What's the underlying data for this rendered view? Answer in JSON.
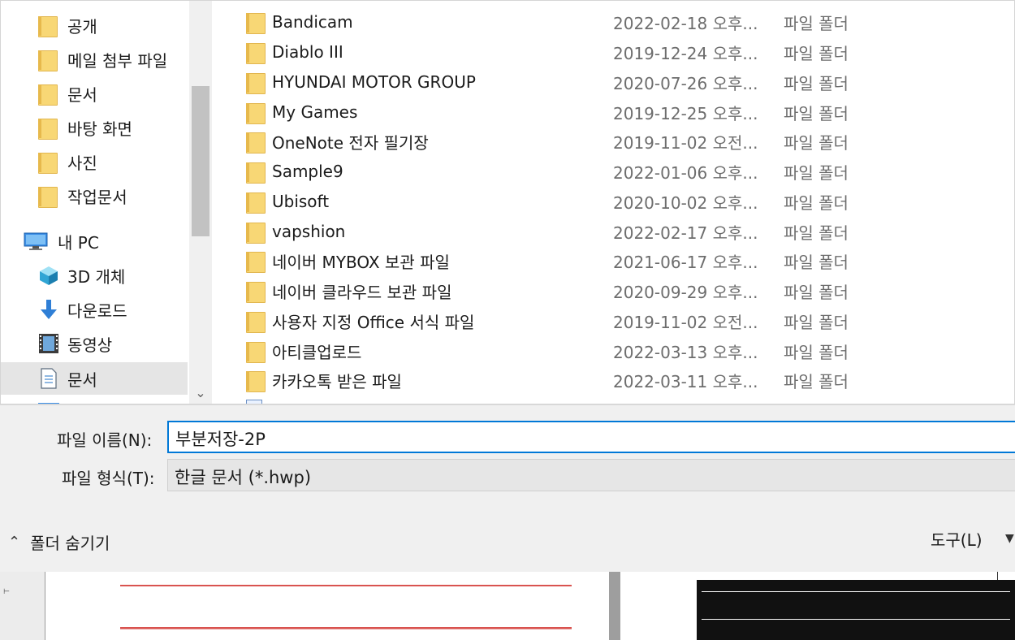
{
  "nav": {
    "items": [
      {
        "label": "공개",
        "icon": "folder-icon"
      },
      {
        "label": "메일 첨부 파일",
        "icon": "folder-icon"
      },
      {
        "label": "문서",
        "icon": "folder-icon"
      },
      {
        "label": "바탕 화면",
        "icon": "folder-icon"
      },
      {
        "label": "사진",
        "icon": "folder-icon"
      },
      {
        "label": "작업문서",
        "icon": "folder-icon"
      },
      {
        "label": "내 PC",
        "icon": "computer-icon"
      },
      {
        "label": "3D 개체",
        "icon": "cube-3d-icon"
      },
      {
        "label": "다운로드",
        "icon": "download-arrow-icon"
      },
      {
        "label": "동영상",
        "icon": "video-film-icon"
      },
      {
        "label": "문서",
        "icon": "document-icon",
        "selected": true
      }
    ]
  },
  "files": [
    {
      "name": "Bandicam",
      "date": "2022-02-18 오후...",
      "type": "파일 폴더"
    },
    {
      "name": "Diablo III",
      "date": "2019-12-24 오후...",
      "type": "파일 폴더"
    },
    {
      "name": "HYUNDAI MOTOR GROUP",
      "date": "2020-07-26 오후...",
      "type": "파일 폴더"
    },
    {
      "name": "My Games",
      "date": "2019-12-25 오후...",
      "type": "파일 폴더"
    },
    {
      "name": "OneNote 전자 필기장",
      "date": "2019-11-02 오전...",
      "type": "파일 폴더"
    },
    {
      "name": "Sample9",
      "date": "2022-01-06 오후...",
      "type": "파일 폴더"
    },
    {
      "name": "Ubisoft",
      "date": "2020-10-02 오후...",
      "type": "파일 폴더"
    },
    {
      "name": "vapshion",
      "date": "2022-02-17 오후...",
      "type": "파일 폴더"
    },
    {
      "name": "네이버 MYBOX 보관 파일",
      "date": "2021-06-17 오후...",
      "type": "파일 폴더"
    },
    {
      "name": "네이버 클라우드 보관 파일",
      "date": "2020-09-29 오후...",
      "type": "파일 폴더"
    },
    {
      "name": "사용자 지정 Office 서식 파일",
      "date": "2019-11-02 오전...",
      "type": "파일 폴더"
    },
    {
      "name": "아티클업로드",
      "date": "2022-03-13 오후...",
      "type": "파일 폴더"
    },
    {
      "name": "카카오톡 받은 파일",
      "date": "2022-03-11 오후...",
      "type": "파일 폴더"
    }
  ],
  "form": {
    "filename_label": "파일 이름(N):",
    "filename_value": "부분저장-2P",
    "filetype_label": "파일 형식(T):",
    "filetype_value": "한글 문서 (*.hwp)",
    "hide_folders_label": "폴더 숨기기",
    "tools_label": "도구(L)"
  },
  "colors": {
    "folder": "#f8d775",
    "accent_border": "#0078d7",
    "selected_bg": "#e5e5e5"
  }
}
